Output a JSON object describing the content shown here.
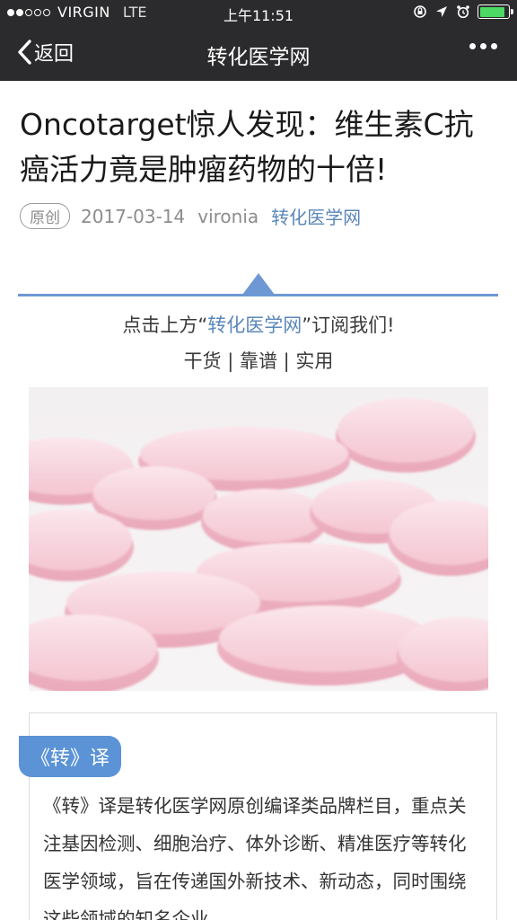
{
  "status_bar": {
    "carrier": "VIRGIN",
    "network": "LTE",
    "time": "上午11:51",
    "signal_dots_filled": 2,
    "signal_dots_total": 5,
    "battery_level": 0.9
  },
  "nav": {
    "back_label": "返回",
    "title": "转化医学网"
  },
  "article": {
    "title": "Oncotarget惊人发现：维生素C抗癌活力竟是肿瘤药物的十倍!",
    "badge": "原创",
    "date": "2017-03-14",
    "author": "vironia",
    "account": "转化医学网"
  },
  "banner": {
    "subscribe_prefix": "点击上方“",
    "subscribe_link": "转化医学网",
    "subscribe_suffix": "”订阅我们!",
    "tagline": "干货 | 靠谱 | 实用"
  },
  "translation": {
    "tag": "《转》译",
    "text": "《转》译是转化医学网原创编译类品牌栏目，重点关注基因检测、细胞治疗、体外诊断、精准医疗等转化医学领域，旨在传递国外新技术、新动态，同时围绕这些领域的知名企业、"
  },
  "colors": {
    "bar_bg": "#2b2b2d",
    "accent_blue": "#6d98d3",
    "link_blue": "#5b87b8",
    "battery_green": "#4cd964",
    "pill_pink": "#f6cdd7"
  }
}
